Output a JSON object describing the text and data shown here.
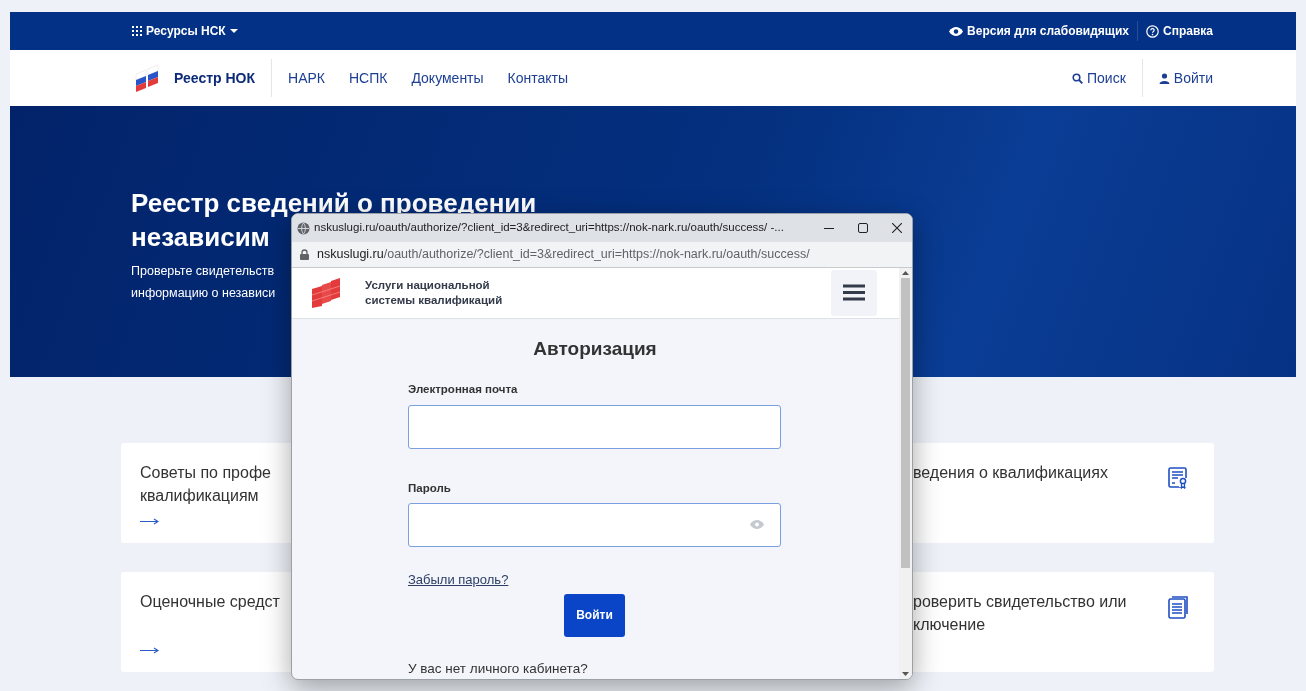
{
  "top_bar": {
    "resources_menu": "Ресурсы НСК",
    "accessibility": "Версия для слабовидящих",
    "help": "Справка"
  },
  "navbar": {
    "brand": "Реестр НОК",
    "links": [
      "НАРК",
      "НСПК",
      "Документы",
      "Контакты"
    ],
    "search": "Поиск",
    "login": "Войти"
  },
  "hero": {
    "title_lines": [
      "Реестр сведений о проведении",
      "независим"
    ],
    "subtitle_lines": [
      "Проверьте свидетельств",
      "информацию о независи"
    ]
  },
  "cards": [
    {
      "lines": [
        "Советы по профе",
        "квалификациям"
      ]
    },
    {
      "lines": [
        "ведения о квалификациях"
      ]
    },
    {
      "lines": [
        "Оценочные средст"
      ]
    },
    {
      "lines": [
        "роверить свидетельство или",
        "ключение"
      ]
    }
  ],
  "popup": {
    "title": "nskuslugi.ru/oauth/authorize/?client_id=3&redirect_uri=https://nok-nark.ru/oauth/success/ -...",
    "url_domain": "nskuslugi.ru",
    "url_path": "/oauth/authorize/?client_id=3&redirect_uri=https://nok-nark.ru/oauth/success/",
    "site_name_lines": [
      "Услуги национальной",
      "системы квалификаций"
    ],
    "heading": "Авторизация",
    "email_label": "Электронная почта",
    "password_label": "Пароль",
    "forgot_link": "Забыли пароль?",
    "submit_button": "Войти",
    "no_account_text": "У вас нет личного кабинета?"
  }
}
